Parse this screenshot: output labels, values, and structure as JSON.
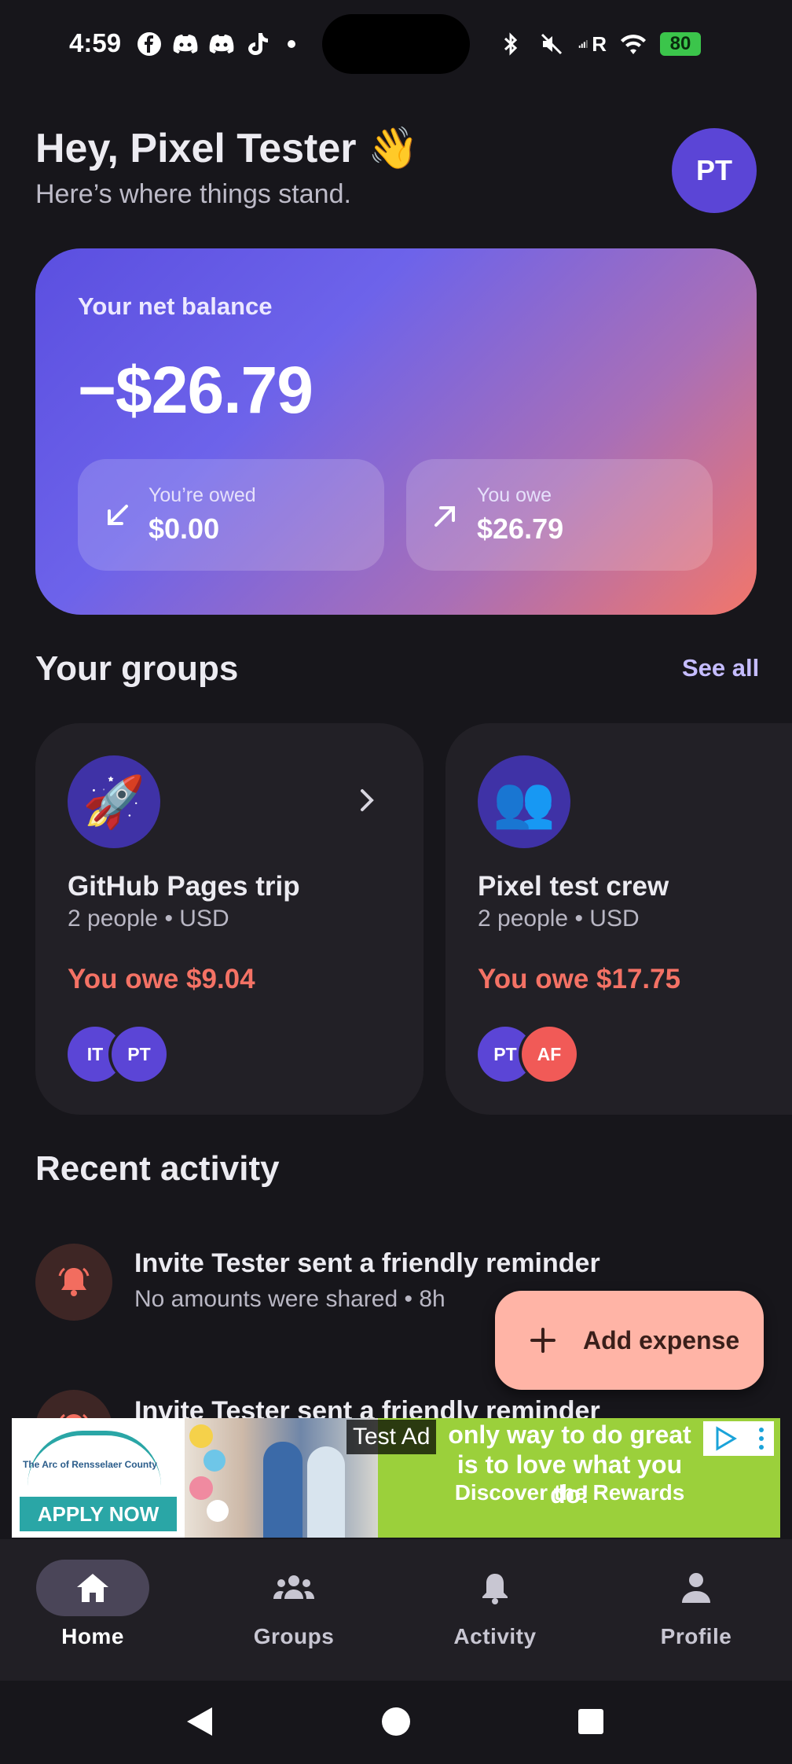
{
  "status_bar": {
    "time": "4:59",
    "carrier_letter": "R",
    "battery": "80"
  },
  "header": {
    "greeting": "Hey, Pixel Tester 👋",
    "subtitle": "Here’s where things stand.",
    "avatar_initials": "PT"
  },
  "balance": {
    "label": "Your net balance",
    "amount": "−$26.79",
    "owed_label": "You’re owed",
    "owed_value": "$0.00",
    "owe_label": "You owe",
    "owe_value": "$26.79"
  },
  "groups": {
    "title": "Your groups",
    "see_all": "See all",
    "items": [
      {
        "emoji": "🚀",
        "name": "GitHub Pages trip",
        "meta": "2 people • USD",
        "status": "You owe $9.04",
        "members": [
          "IT",
          "PT"
        ]
      },
      {
        "emoji": "👥",
        "name": "Pixel test crew",
        "meta": "2 people • USD",
        "status": "You owe $17.75",
        "members": [
          "PT",
          "AF"
        ]
      }
    ]
  },
  "activity": {
    "title": "Recent activity",
    "items": [
      {
        "title": "Invite Tester sent a friendly reminder",
        "subtitle": "No amounts were shared • 8h"
      },
      {
        "title": "Invite Tester sent a friendly reminder",
        "subtitle": ""
      }
    ]
  },
  "fab": {
    "label": "Add expense"
  },
  "ad": {
    "tag": "Test Ad",
    "apply": "APPLY NOW",
    "logo_text": "The Arc of Rensselaer County",
    "headline": "only way to do great is to love what you do!",
    "cta": "Discover the Rewards"
  },
  "nav": {
    "items": [
      {
        "label": "Home",
        "icon": "home-icon",
        "active": true
      },
      {
        "label": "Groups",
        "icon": "groups-icon",
        "active": false
      },
      {
        "label": "Activity",
        "icon": "bell-icon",
        "active": false
      },
      {
        "label": "Profile",
        "icon": "person-icon",
        "active": false
      }
    ]
  },
  "colors": {
    "background": "#17161b",
    "card": "#222026",
    "accent": "#5b45d6",
    "owe_red": "#f47265",
    "fab": "#ffb4a6"
  }
}
